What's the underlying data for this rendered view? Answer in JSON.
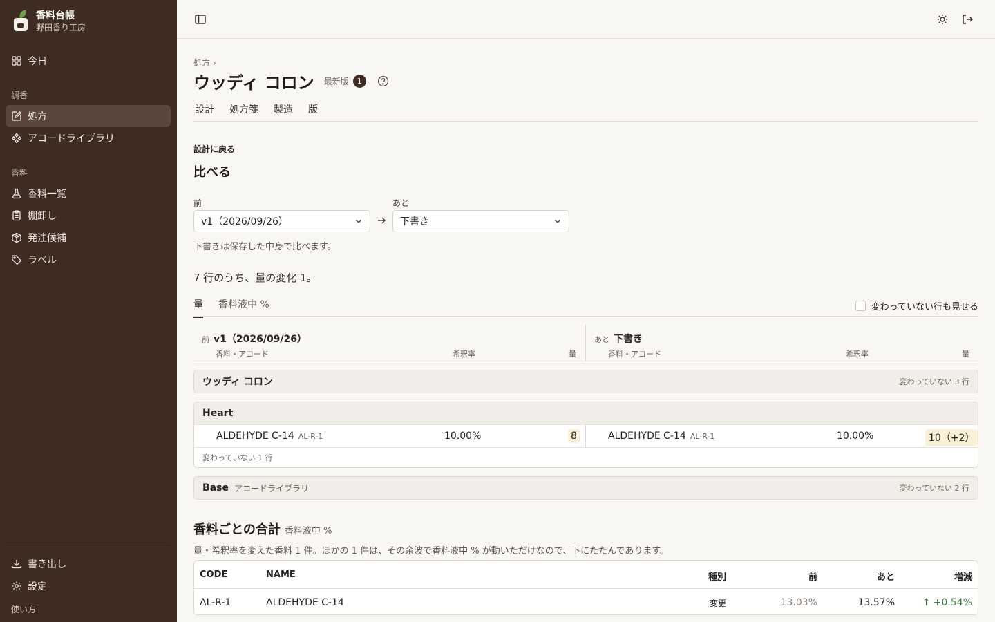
{
  "brand": {
    "name": "香料台帳",
    "subtitle": "野田香り工房"
  },
  "sidebar": {
    "today": "今日",
    "section_blend": "調香",
    "section_materials": "香料",
    "items": [
      {
        "label": "処方",
        "icon": "edit-icon",
        "active": true
      },
      {
        "label": "アコードライブラリ",
        "icon": "components-icon"
      },
      {
        "label": "香料一覧",
        "icon": "flask-icon"
      },
      {
        "label": "棚卸し",
        "icon": "clipboard-icon"
      },
      {
        "label": "発注候補",
        "icon": "package-icon"
      },
      {
        "label": "ラベル",
        "icon": "tag-icon"
      }
    ],
    "export": "書き出し",
    "settings": "設定",
    "usage": "使い方"
  },
  "topbar": {
    "sidebar_toggle_icon": "panel-left-icon",
    "theme_icon": "sun-icon",
    "logout_icon": "logout-icon"
  },
  "breadcrumb": "処方",
  "page": {
    "title": "ウッディ コロン",
    "version_label": "最新版",
    "version_badge": "1",
    "tabs": [
      "設計",
      "処方箋",
      "製造",
      "版"
    ]
  },
  "compare": {
    "back_link": "設計に戻る",
    "title": "比べる",
    "before_label": "前",
    "before_value": "v1（2026/09/26）",
    "after_label": "あと",
    "after_value": "下書き",
    "hint": "下書きは保存した中身で比べます。",
    "summary": "7 行のうち、量の変化 1。",
    "subtabs": [
      "量",
      "香料液中 %"
    ],
    "show_unchanged": "変わっていない行も見せる",
    "col_before_prefix": "前",
    "col_before_version": "v1（2026/09/26）",
    "col_after_prefix": "あと",
    "col_after_version": "下書き",
    "col_headers": {
      "material": "香料・アコード",
      "dilution": "希釈率",
      "amount": "量"
    }
  },
  "groups": {
    "top": {
      "name": "ウッディ コロン",
      "unchanged": "変わっていない 3 行"
    },
    "heart": {
      "name": "Heart",
      "row": {
        "before_name": "ALDEHYDE C-14",
        "before_code": "AL-R-1",
        "before_dilution": "10.00%",
        "before_amount": "8",
        "after_name": "ALDEHYDE C-14",
        "after_code": "AL-R-1",
        "after_dilution": "10.00%",
        "after_amount": "10（+2）"
      },
      "unchanged": "変わっていない 1 行"
    },
    "base": {
      "name": "Base",
      "sub": "アコードライブラリ",
      "unchanged": "変わっていない 2 行"
    }
  },
  "totals": {
    "title": "香料ごとの合計",
    "subtitle": "香料液中 %",
    "note": "量・希釈率を変えた香料 1 件。ほかの 1 件は、その余波で香料液中 % が動いただけなので、下にたたんであります。",
    "headers": {
      "code": "CODE",
      "name": "NAME",
      "kind": "種別",
      "before": "前",
      "after": "あと",
      "delta": "増減"
    },
    "rows": [
      {
        "code": "AL-R-1",
        "name": "ALDEHYDE C-14",
        "kind": "変更",
        "before": "13.03%",
        "after": "13.57%",
        "delta": "↑ +0.54%"
      }
    ]
  },
  "colors": {
    "sidebar_bg": "#3e2c23",
    "active_item_bg": "#5a463b",
    "page_bg": "#f8f7f4",
    "increase": "#3d7a3f",
    "highlight": "#fbf0d6"
  }
}
